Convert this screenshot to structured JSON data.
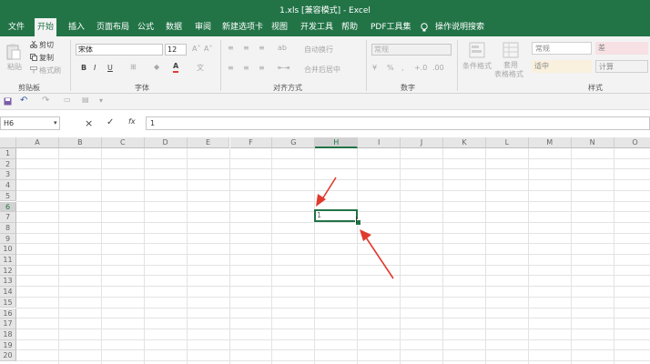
{
  "window": {
    "title": "1.xls [兼容模式] - Excel"
  },
  "tabs": [
    "文件",
    "开始",
    "插入",
    "页面布局",
    "公式",
    "数据",
    "审阅",
    "新建选项卡",
    "视图",
    "开发工具",
    "帮助",
    "PDF工具集"
  ],
  "tell_me": "操作说明搜索",
  "ribbon": {
    "clipboard": {
      "label": "剪贴板",
      "paste": "粘贴",
      "cut": "剪切",
      "copy": "复制",
      "format_painter": "格式刷"
    },
    "font": {
      "label": "字体",
      "name": "宋体",
      "size": "12",
      "bold": "B",
      "italic": "I",
      "underline": "U"
    },
    "alignment": {
      "label": "对齐方式",
      "wrap": "自动换行",
      "merge": "合并后居中"
    },
    "number": {
      "label": "数字",
      "format": "常规",
      "percent": "%",
      "comma": ",",
      "inc": "+.0",
      "dec": ".00"
    },
    "styles": {
      "label": "样式",
      "conditional": "条件格式",
      "table": "套用",
      "table2": "表格格式",
      "normal": "常规",
      "bad": "差",
      "neutral": "适中",
      "calc": "计算"
    }
  },
  "formula_bar": {
    "name_box": "H6",
    "cancel": "×",
    "enter": "✓",
    "fx": "fx",
    "content": "1"
  },
  "sheet": {
    "columns": [
      "A",
      "B",
      "C",
      "D",
      "E",
      "F",
      "G",
      "H",
      "I",
      "J",
      "K",
      "L",
      "M",
      "N",
      "O"
    ],
    "rows": [
      "1",
      "2",
      "3",
      "4",
      "5",
      "6",
      "7",
      "8",
      "9",
      "10",
      "11",
      "12",
      "13",
      "14",
      "15",
      "16",
      "17",
      "18",
      "19",
      "20"
    ],
    "active_column": "H",
    "active_row": "6",
    "active_value": "1"
  },
  "colors": {
    "excel_green": "#217346",
    "arrow": "#e03a2f"
  }
}
